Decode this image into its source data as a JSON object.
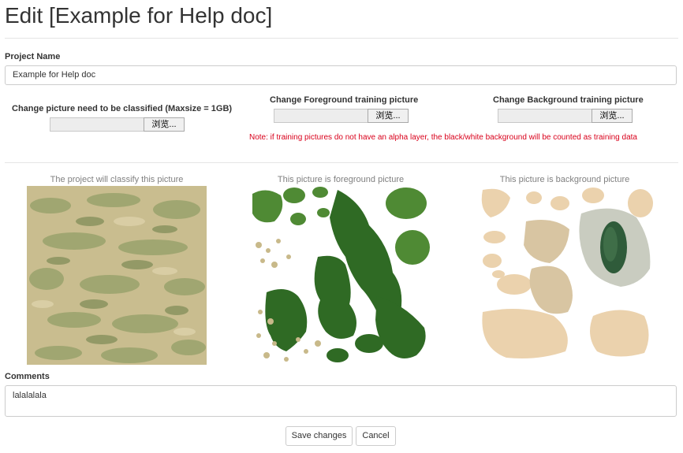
{
  "page": {
    "title": "Edit [Example for Help doc]"
  },
  "project": {
    "name_label": "Project Name",
    "name_value": "Example for Help doc"
  },
  "uploads": [
    {
      "label": "Change picture need to be classified (Maxsize = 1GB)",
      "browse_label": "浏览..."
    },
    {
      "label": "Change Foreground training picture",
      "browse_label": "浏览..."
    },
    {
      "label": "Change Background training picture",
      "browse_label": "浏览..."
    }
  ],
  "note": "Note: if training pictures do not have an alpha layer, the black/white background will be counted as training data",
  "previews": [
    {
      "caption": "The project will classify this picture"
    },
    {
      "caption": "This picture is foreground picture"
    },
    {
      "caption": "This picture is background picture"
    }
  ],
  "comments": {
    "label": "Comments",
    "value": "lalalalala"
  },
  "actions": {
    "save_label": "Save changes",
    "cancel_label": "Cancel"
  }
}
